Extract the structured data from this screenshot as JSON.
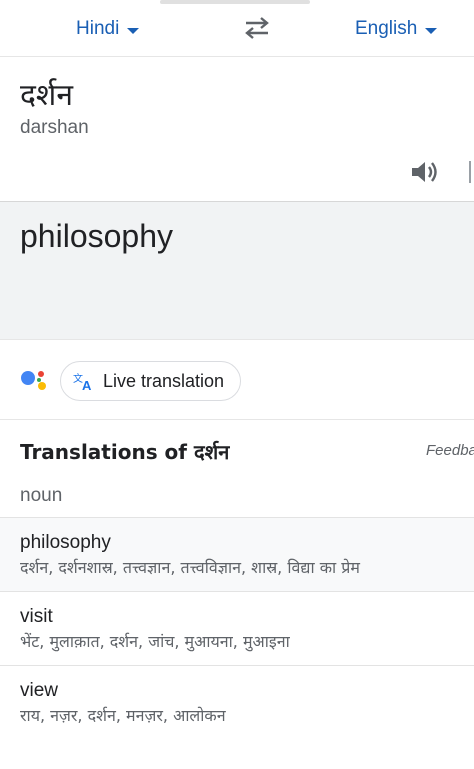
{
  "languages": {
    "source": "Hindi",
    "target": "English"
  },
  "source": {
    "text": "दर्शन",
    "transliteration": "darshan"
  },
  "target": {
    "text": "philosophy"
  },
  "assistant": {
    "live_label": "Live translation"
  },
  "translations": {
    "title_prefix": "Translations of ",
    "title_word": "दर्शन",
    "feedback": "Feedba",
    "pos": "noun",
    "entries": [
      {
        "word": "philosophy",
        "synonyms": "दर्शन, दर्शनशास्र, तत्त्वज्ञान, तत्त्वविज्ञान, शास्र, विद्या का प्रेम"
      },
      {
        "word": "visit",
        "synonyms": "भेंट, मुलाक़ात, दर्शन, जांच, मुआयना, मुआइना"
      },
      {
        "word": "view",
        "synonyms": "राय, नज़र, दर्शन, मनज़र, आलोकन"
      }
    ]
  },
  "colors": {
    "accent": "#1a5fb4",
    "target_bg": "#f1f3f4"
  },
  "icons": [
    "chevron-down-icon",
    "swap-icon",
    "speaker-icon",
    "google-assistant-icon",
    "translate-icon"
  ]
}
